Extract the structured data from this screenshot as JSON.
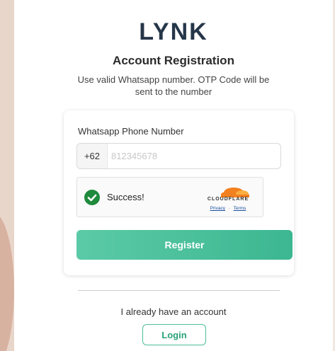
{
  "brand": {
    "logo_text": "LYNK"
  },
  "header": {
    "title": "Account Registration",
    "subtitle": "Use valid Whatsapp number. OTP Code will be sent to the number"
  },
  "form": {
    "phone_label": "Whatsapp Phone Number",
    "country_code": "+62",
    "phone_placeholder": "812345678",
    "phone_value": ""
  },
  "captcha": {
    "status_text": "Success!",
    "provider": "CLOUDFLARE",
    "privacy_label": "Privacy",
    "separator": "·",
    "terms_label": "Terms"
  },
  "actions": {
    "register_label": "Register",
    "already_text": "I already have an account",
    "login_label": "Login"
  },
  "colors": {
    "accent": "#3cb791",
    "success": "#1f8a3c",
    "cloudflare": "#f38020"
  }
}
